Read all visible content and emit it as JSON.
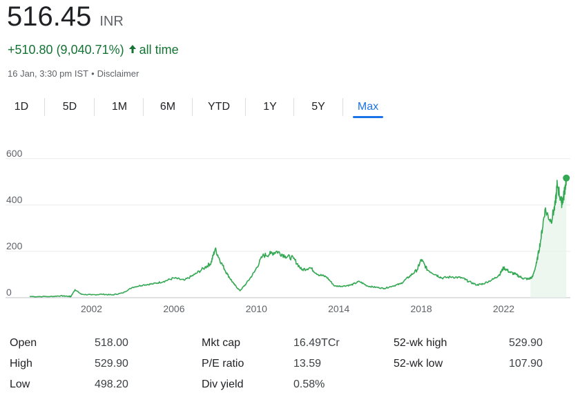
{
  "quote": {
    "price": "516.45",
    "currency": "INR",
    "change": "+510.80 (9,040.71%)",
    "period": "all time",
    "timestamp": "16 Jan, 3:30 pm IST",
    "disclaimer": "Disclaimer",
    "change_color": "#137333"
  },
  "tabs": [
    {
      "label": "1D",
      "active": false
    },
    {
      "label": "5D",
      "active": false
    },
    {
      "label": "1M",
      "active": false
    },
    {
      "label": "6M",
      "active": false
    },
    {
      "label": "YTD",
      "active": false
    },
    {
      "label": "1Y",
      "active": false
    },
    {
      "label": "5Y",
      "active": false
    },
    {
      "label": "Max",
      "active": true
    }
  ],
  "chart_data": {
    "type": "line",
    "x": [
      1999.0,
      2000.0,
      2000.5,
      2000.9,
      2001.0,
      2001.2,
      2001.5,
      2002.0,
      2002.5,
      2003.0,
      2003.5,
      2004.0,
      2004.5,
      2005.0,
      2005.5,
      2006.0,
      2006.5,
      2007.0,
      2007.5,
      2007.8,
      2008.0,
      2008.3,
      2008.6,
      2008.9,
      2009.2,
      2009.5,
      2009.9,
      2010.3,
      2010.7,
      2011.0,
      2011.4,
      2011.8,
      2012.2,
      2012.6,
      2013.0,
      2013.4,
      2013.8,
      2014.2,
      2014.6,
      2015.0,
      2015.4,
      2015.8,
      2016.2,
      2016.6,
      2017.0,
      2017.4,
      2017.8,
      2018.0,
      2018.3,
      2018.7,
      2019.0,
      2019.5,
      2020.0,
      2020.3,
      2020.7,
      2021.0,
      2021.5,
      2021.8,
      2022.0,
      2022.3,
      2022.6,
      2022.9,
      2023.2,
      2023.4,
      2023.6,
      2023.8,
      2024.0,
      2024.3,
      2024.5,
      2024.6,
      2024.8,
      2024.9,
      2025.04
    ],
    "y": [
      5,
      5,
      8,
      6,
      5,
      35,
      15,
      12,
      15,
      12,
      20,
      45,
      55,
      60,
      70,
      85,
      75,
      100,
      130,
      150,
      210,
      150,
      100,
      60,
      30,
      60,
      110,
      180,
      190,
      200,
      180,
      170,
      120,
      130,
      100,
      90,
      50,
      50,
      55,
      70,
      50,
      45,
      40,
      50,
      60,
      90,
      120,
      165,
      120,
      100,
      85,
      90,
      85,
      70,
      55,
      60,
      80,
      100,
      130,
      110,
      100,
      85,
      80,
      90,
      150,
      250,
      380,
      330,
      400,
      490,
      410,
      430,
      516.45
    ],
    "xlim": [
      1999.0,
      2025.1
    ],
    "ylim": [
      0,
      650
    ],
    "xticks": [
      "2002",
      "2006",
      "2010",
      "2014",
      "2018",
      "2022"
    ],
    "yticks": [
      "0",
      "200",
      "400",
      "600"
    ],
    "grid": true,
    "line_color": "#34a853",
    "fill_color": "#e6f4ea"
  },
  "stats": {
    "left": [
      {
        "label": "Open",
        "value": "518.00"
      },
      {
        "label": "High",
        "value": "529.90"
      },
      {
        "label": "Low",
        "value": "498.20"
      }
    ],
    "middle": [
      {
        "label": "Mkt cap",
        "value": "16.49TCr"
      },
      {
        "label": "P/E ratio",
        "value": "13.59"
      },
      {
        "label": "Div yield",
        "value": "0.58%"
      }
    ],
    "right": [
      {
        "label": "52-wk high",
        "value": "529.90"
      },
      {
        "label": "52-wk low",
        "value": "107.90"
      }
    ]
  }
}
